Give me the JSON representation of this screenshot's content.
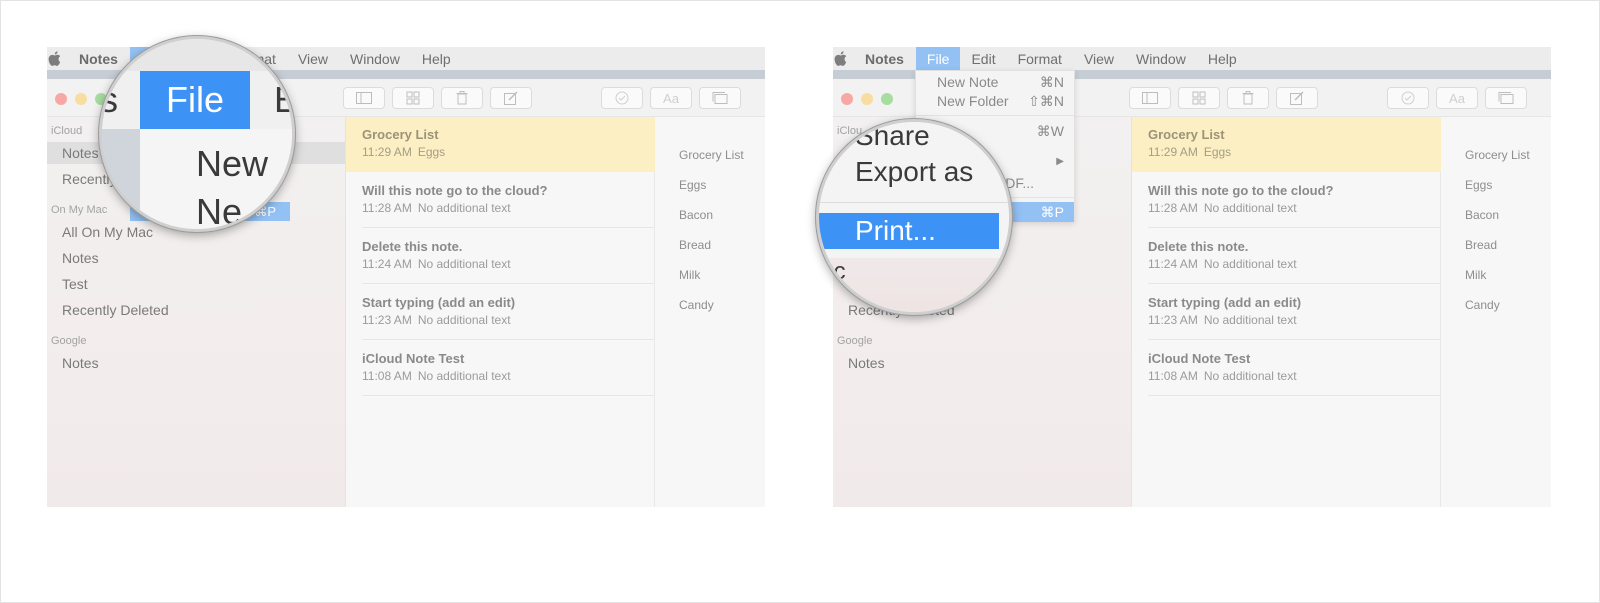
{
  "menubar": {
    "app": "Notes",
    "items": [
      "File",
      "Edit",
      "Format",
      "View",
      "Window",
      "Help"
    ],
    "active": "File"
  },
  "toolbar_icons": [
    "sidebar-icon",
    "grid-icon",
    "trash-icon",
    "compose-icon",
    "checklist-icon",
    "text-format-icon",
    "attachments-icon"
  ],
  "sidebar": {
    "icloud_label": "iCloud",
    "icloud_items": [
      "Notes",
      "Recently Deleted"
    ],
    "onmymac_label": "On My Mac",
    "onmymac_items": [
      "All On My Mac",
      "Notes",
      "Test",
      "Recently Deleted"
    ],
    "google_label": "Google",
    "google_items": [
      "Notes"
    ],
    "left_truncated": [
      "Notes",
      "Recently"
    ],
    "right_truncated": [
      "iClou",
      "Recently Deleted"
    ]
  },
  "notes": [
    {
      "title": "Grocery List",
      "time": "11:29 AM",
      "preview": "Eggs",
      "selected": true
    },
    {
      "title": "Will this note go to the cloud?",
      "time": "11:28 AM",
      "preview": "No additional text"
    },
    {
      "title": "Delete this note.",
      "time": "11:24 AM",
      "preview": "No additional text"
    },
    {
      "title": "Start typing (add an edit)",
      "time": "11:23 AM",
      "preview": "No additional text"
    },
    {
      "title": "iCloud Note Test",
      "time": "11:08 AM",
      "preview": "No additional text"
    }
  ],
  "editor_lines": [
    "Grocery List",
    "Eggs",
    "Bacon",
    "Bread",
    "Milk",
    "Candy"
  ],
  "file_menu": {
    "new_note": "New Note",
    "new_note_sc": "⌘N",
    "new_folder": "New Folder",
    "new_folder_sc": "⇧⌘N",
    "share_sc": "⌘W",
    "export_fragment": "PDF...",
    "print_sc": "⌘P"
  },
  "lens_left": {
    "menu_label": "File",
    "prev_fragment": "s",
    "next_fragment": "E",
    "row1": "New",
    "row2": "Ne"
  },
  "lens_right": {
    "share": "Share",
    "export": "Export as",
    "print": "Print...",
    "mac_fragment": "lac"
  },
  "colors": {
    "menu_highlight": "#93c1f3",
    "selected_note": "#fcefc4",
    "print_highlight": "#3d93f5"
  }
}
